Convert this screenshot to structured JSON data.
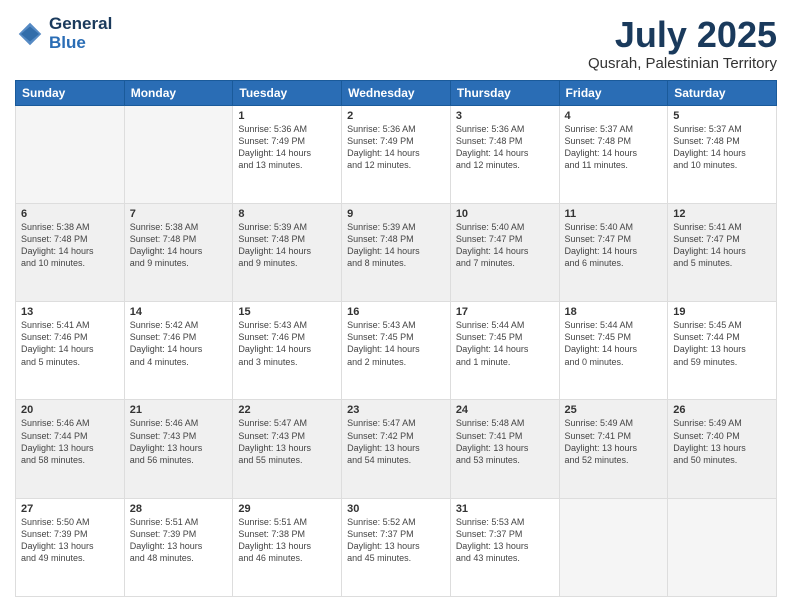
{
  "header": {
    "logo_line1": "General",
    "logo_line2": "Blue",
    "title": "July 2025",
    "subtitle": "Qusrah, Palestinian Territory"
  },
  "weekdays": [
    "Sunday",
    "Monday",
    "Tuesday",
    "Wednesday",
    "Thursday",
    "Friday",
    "Saturday"
  ],
  "weeks": [
    [
      {
        "day": "",
        "info": ""
      },
      {
        "day": "",
        "info": ""
      },
      {
        "day": "1",
        "info": "Sunrise: 5:36 AM\nSunset: 7:49 PM\nDaylight: 14 hours\nand 13 minutes."
      },
      {
        "day": "2",
        "info": "Sunrise: 5:36 AM\nSunset: 7:49 PM\nDaylight: 14 hours\nand 12 minutes."
      },
      {
        "day": "3",
        "info": "Sunrise: 5:36 AM\nSunset: 7:48 PM\nDaylight: 14 hours\nand 12 minutes."
      },
      {
        "day": "4",
        "info": "Sunrise: 5:37 AM\nSunset: 7:48 PM\nDaylight: 14 hours\nand 11 minutes."
      },
      {
        "day": "5",
        "info": "Sunrise: 5:37 AM\nSunset: 7:48 PM\nDaylight: 14 hours\nand 10 minutes."
      }
    ],
    [
      {
        "day": "6",
        "info": "Sunrise: 5:38 AM\nSunset: 7:48 PM\nDaylight: 14 hours\nand 10 minutes."
      },
      {
        "day": "7",
        "info": "Sunrise: 5:38 AM\nSunset: 7:48 PM\nDaylight: 14 hours\nand 9 minutes."
      },
      {
        "day": "8",
        "info": "Sunrise: 5:39 AM\nSunset: 7:48 PM\nDaylight: 14 hours\nand 9 minutes."
      },
      {
        "day": "9",
        "info": "Sunrise: 5:39 AM\nSunset: 7:48 PM\nDaylight: 14 hours\nand 8 minutes."
      },
      {
        "day": "10",
        "info": "Sunrise: 5:40 AM\nSunset: 7:47 PM\nDaylight: 14 hours\nand 7 minutes."
      },
      {
        "day": "11",
        "info": "Sunrise: 5:40 AM\nSunset: 7:47 PM\nDaylight: 14 hours\nand 6 minutes."
      },
      {
        "day": "12",
        "info": "Sunrise: 5:41 AM\nSunset: 7:47 PM\nDaylight: 14 hours\nand 5 minutes."
      }
    ],
    [
      {
        "day": "13",
        "info": "Sunrise: 5:41 AM\nSunset: 7:46 PM\nDaylight: 14 hours\nand 5 minutes."
      },
      {
        "day": "14",
        "info": "Sunrise: 5:42 AM\nSunset: 7:46 PM\nDaylight: 14 hours\nand 4 minutes."
      },
      {
        "day": "15",
        "info": "Sunrise: 5:43 AM\nSunset: 7:46 PM\nDaylight: 14 hours\nand 3 minutes."
      },
      {
        "day": "16",
        "info": "Sunrise: 5:43 AM\nSunset: 7:45 PM\nDaylight: 14 hours\nand 2 minutes."
      },
      {
        "day": "17",
        "info": "Sunrise: 5:44 AM\nSunset: 7:45 PM\nDaylight: 14 hours\nand 1 minute."
      },
      {
        "day": "18",
        "info": "Sunrise: 5:44 AM\nSunset: 7:45 PM\nDaylight: 14 hours\nand 0 minutes."
      },
      {
        "day": "19",
        "info": "Sunrise: 5:45 AM\nSunset: 7:44 PM\nDaylight: 13 hours\nand 59 minutes."
      }
    ],
    [
      {
        "day": "20",
        "info": "Sunrise: 5:46 AM\nSunset: 7:44 PM\nDaylight: 13 hours\nand 58 minutes."
      },
      {
        "day": "21",
        "info": "Sunrise: 5:46 AM\nSunset: 7:43 PM\nDaylight: 13 hours\nand 56 minutes."
      },
      {
        "day": "22",
        "info": "Sunrise: 5:47 AM\nSunset: 7:43 PM\nDaylight: 13 hours\nand 55 minutes."
      },
      {
        "day": "23",
        "info": "Sunrise: 5:47 AM\nSunset: 7:42 PM\nDaylight: 13 hours\nand 54 minutes."
      },
      {
        "day": "24",
        "info": "Sunrise: 5:48 AM\nSunset: 7:41 PM\nDaylight: 13 hours\nand 53 minutes."
      },
      {
        "day": "25",
        "info": "Sunrise: 5:49 AM\nSunset: 7:41 PM\nDaylight: 13 hours\nand 52 minutes."
      },
      {
        "day": "26",
        "info": "Sunrise: 5:49 AM\nSunset: 7:40 PM\nDaylight: 13 hours\nand 50 minutes."
      }
    ],
    [
      {
        "day": "27",
        "info": "Sunrise: 5:50 AM\nSunset: 7:39 PM\nDaylight: 13 hours\nand 49 minutes."
      },
      {
        "day": "28",
        "info": "Sunrise: 5:51 AM\nSunset: 7:39 PM\nDaylight: 13 hours\nand 48 minutes."
      },
      {
        "day": "29",
        "info": "Sunrise: 5:51 AM\nSunset: 7:38 PM\nDaylight: 13 hours\nand 46 minutes."
      },
      {
        "day": "30",
        "info": "Sunrise: 5:52 AM\nSunset: 7:37 PM\nDaylight: 13 hours\nand 45 minutes."
      },
      {
        "day": "31",
        "info": "Sunrise: 5:53 AM\nSunset: 7:37 PM\nDaylight: 13 hours\nand 43 minutes."
      },
      {
        "day": "",
        "info": ""
      },
      {
        "day": "",
        "info": ""
      }
    ]
  ]
}
